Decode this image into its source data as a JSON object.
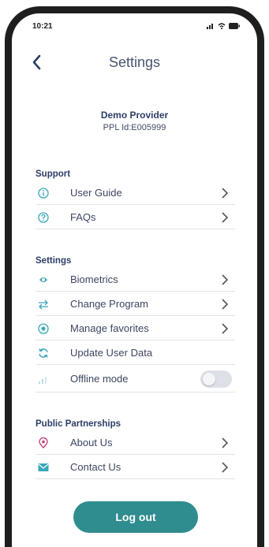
{
  "status_bar": {
    "time": "10:21"
  },
  "header": {
    "title": "Settings"
  },
  "provider": {
    "name": "Demo Provider",
    "id": "PPL Id:E005999"
  },
  "sections": {
    "support": {
      "title": "Support",
      "items": [
        {
          "label": "User Guide",
          "icon": "info-icon"
        },
        {
          "label": "FAQs",
          "icon": "question-icon"
        }
      ]
    },
    "settings": {
      "title": "Settings",
      "items": [
        {
          "label": "Biometrics",
          "icon": "fingerprint-icon"
        },
        {
          "label": "Change Program",
          "icon": "swap-arrows-icon"
        },
        {
          "label": "Manage favorites",
          "icon": "target-icon"
        },
        {
          "label": "Update User Data",
          "icon": "refresh-icon"
        },
        {
          "label": "Offline mode",
          "icon": "signal-icon",
          "toggle": false
        }
      ]
    },
    "partnerships": {
      "title": "Public Partnerships",
      "items": [
        {
          "label": "About Us",
          "icon": "location-pin-icon"
        },
        {
          "label": "Contact Us",
          "icon": "mail-icon"
        }
      ]
    }
  },
  "logout_label": "Log out",
  "colors": {
    "accent": "#2f8c8f",
    "icon_teal": "#3aa6b9",
    "icon_pink": "#c2387a",
    "title_navy": "#2c3d68"
  }
}
